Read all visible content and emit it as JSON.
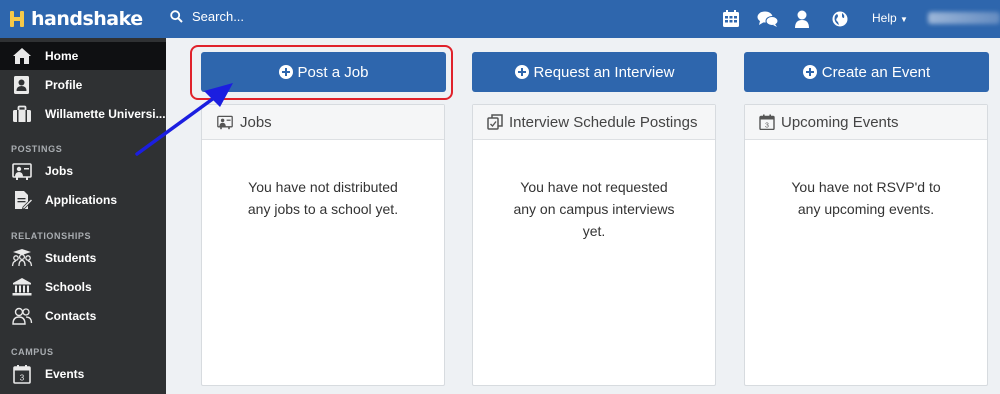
{
  "app": {
    "name": "handshake"
  },
  "topbar": {
    "search_placeholder": "Search...",
    "help_label": "Help",
    "icons": [
      "calendar-icon",
      "chat-icon",
      "user-icon",
      "globe-icon"
    ]
  },
  "sidebar": {
    "items": [
      {
        "label": "Home",
        "icon": "home-icon",
        "active": true
      },
      {
        "label": "Profile",
        "icon": "profile-icon"
      },
      {
        "label": "Willamette Universi...",
        "icon": "briefcase-icon"
      }
    ],
    "sections": [
      {
        "label": "POSTINGS",
        "items": [
          {
            "label": "Jobs",
            "icon": "jobs-icon"
          },
          {
            "label": "Applications",
            "icon": "applications-icon"
          }
        ]
      },
      {
        "label": "RELATIONSHIPS",
        "items": [
          {
            "label": "Students",
            "icon": "students-icon"
          },
          {
            "label": "Schools",
            "icon": "schools-icon"
          },
          {
            "label": "Contacts",
            "icon": "contacts-icon"
          }
        ]
      },
      {
        "label": "CAMPUS",
        "items": [
          {
            "label": "Events",
            "icon": "events-icon"
          }
        ]
      }
    ]
  },
  "main": {
    "buttons": [
      {
        "label": "Post a Job"
      },
      {
        "label": "Request an Interview"
      },
      {
        "label": "Create an Event"
      }
    ],
    "cards": [
      {
        "title": "Jobs",
        "icon": "jobs-icon",
        "lines": [
          "You have not distributed",
          "any jobs to a school yet."
        ]
      },
      {
        "title": "Interview Schedule Postings",
        "icon": "postings-icon",
        "lines": [
          "You have not requested",
          "any on campus interviews",
          "yet."
        ]
      },
      {
        "title": "Upcoming Events",
        "icon": "calendar-icon",
        "lines": [
          "You have not RSVP'd to",
          "any upcoming events."
        ]
      }
    ]
  },
  "colors": {
    "brand": "#2e66ad",
    "sidebar": "#2f3133",
    "highlight": "#e0222b",
    "arrow": "#1b1ee0"
  }
}
